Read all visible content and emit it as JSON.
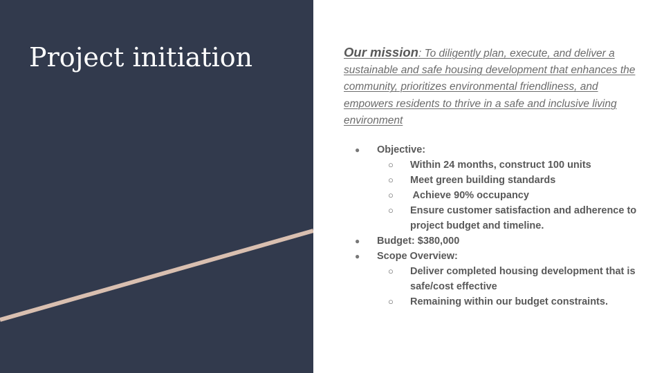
{
  "slide": {
    "title": "Project initiation",
    "mission_label": "Our mission",
    "mission_text": ": To diligently plan, execute, and deliver a sustainable and safe housing development that enhances the community, prioritizes environmental friendliness, and empowers residents to thrive in a safe and inclusive living environment",
    "bullet_glyph": "●",
    "sub_bullet_glyph": "○",
    "objective_label": "Objective:",
    "objectives": [
      "Within 24 months, construct 100 units",
      "Meet green building standards",
      " Achieve 90% occupancy",
      "Ensure customer satisfaction and adherence to project budget and timeline."
    ],
    "budget_label": "Budget: $380,000",
    "scope_label": "Scope Overview:",
    "scope_items": [
      "Deliver completed housing development that is safe/cost effective",
      "Remaining within our budget constraints."
    ]
  },
  "colors": {
    "left_panel": "#323a4d",
    "accent_line": "#d9bfb0",
    "text_gray": "#595959"
  }
}
